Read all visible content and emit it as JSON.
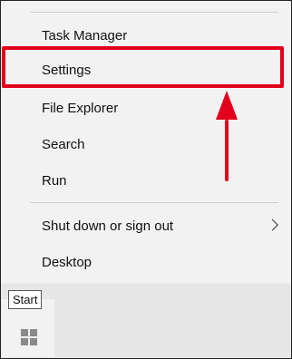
{
  "menu": {
    "items": [
      {
        "label": "Task Manager"
      },
      {
        "label": "Settings"
      },
      {
        "label": "File Explorer"
      },
      {
        "label": "Search"
      },
      {
        "label": "Run"
      },
      {
        "label": "Shut down or sign out"
      },
      {
        "label": "Desktop"
      }
    ]
  },
  "taskbar": {
    "start_tooltip": "Start",
    "start_icon": "windows-logo-icon"
  },
  "annotation": {
    "highlight_color": "#e2001a",
    "highlighted_item": "Settings"
  }
}
